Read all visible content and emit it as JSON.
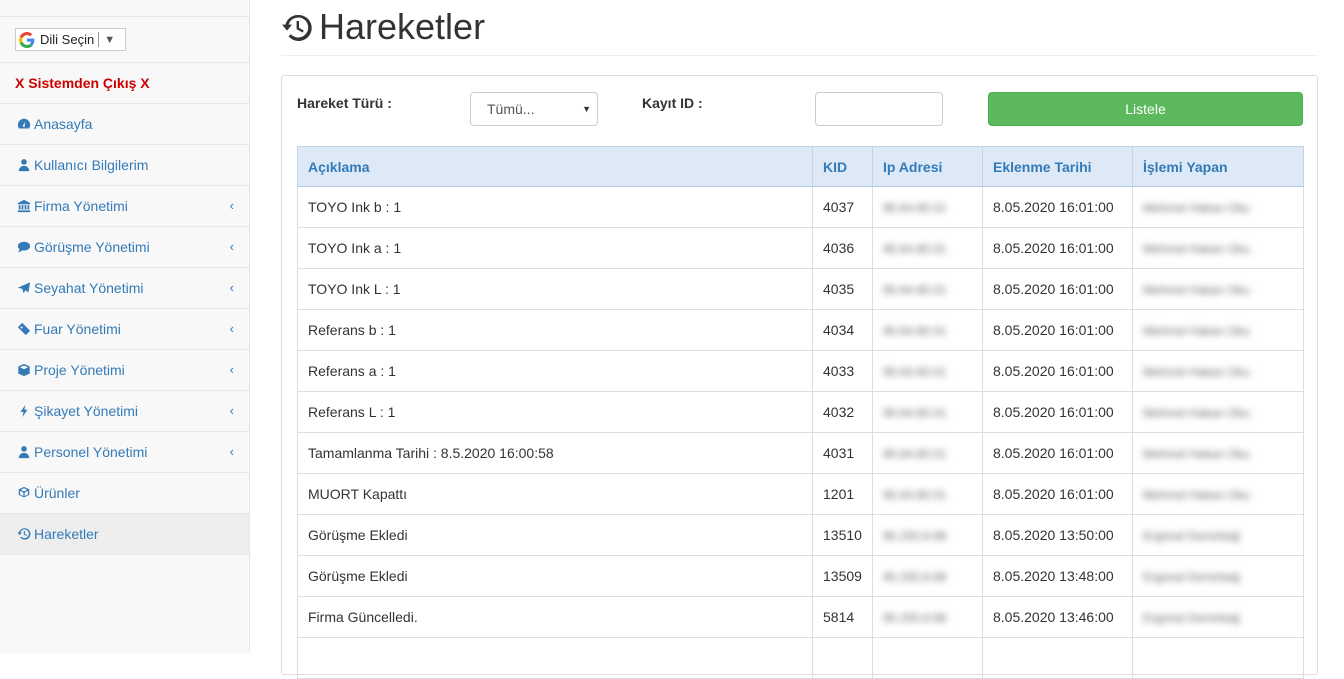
{
  "language": {
    "label": "Dili Seçin",
    "arrow": "▼"
  },
  "sidebar": {
    "exit_label": "X Sistemden Çıkış X",
    "items": [
      {
        "label": "Anasayfa",
        "icon": "dashboard-icon"
      },
      {
        "label": "Kullanıcı Bilgilerim",
        "icon": "user-icon"
      },
      {
        "label": "Firma Yönetimi",
        "icon": "bank-icon",
        "expandable": true
      },
      {
        "label": "Görüşme Yönetimi",
        "icon": "comments-icon",
        "expandable": true
      },
      {
        "label": "Seyahat Yönetimi",
        "icon": "plane-icon",
        "expandable": true
      },
      {
        "label": "Fuar Yönetimi",
        "icon": "ticket-icon",
        "expandable": true
      },
      {
        "label": "Proje Yönetimi",
        "icon": "cube-icon",
        "expandable": true
      },
      {
        "label": "Şikayet Yönetimi",
        "icon": "bolt-icon",
        "expandable": true
      },
      {
        "label": "Personel Yönetimi",
        "icon": "user-icon",
        "expandable": true
      },
      {
        "label": "Ürünler",
        "icon": "cubes-icon"
      },
      {
        "label": "Hareketler",
        "icon": "history-icon",
        "active": true
      }
    ],
    "chevron": "‹"
  },
  "page": {
    "title": "Hareketler"
  },
  "filters": {
    "type_label": "Hareket Türü :",
    "type_selected": "Tümü...",
    "id_label": "Kayıt ID :",
    "id_value": "",
    "submit_label": "Listele"
  },
  "table": {
    "headers": [
      "Açıklama",
      "KID",
      "Ip Adresi",
      "Eklenme Tarihi",
      "İşlemi Yapan"
    ],
    "rows": [
      [
        "TOYO Ink b : 1",
        "4037",
        "95.64.80.01",
        "8.05.2020 16:01:00",
        "Mehmet Hakan Oku"
      ],
      [
        "TOYO Ink a : 1",
        "4036",
        "95.64.80.01",
        "8.05.2020 16:01:00",
        "Mehmet Hakan Oku"
      ],
      [
        "TOYO Ink L : 1",
        "4035",
        "95.64.80.01",
        "8.05.2020 16:01:00",
        "Mehmet Hakan Oku"
      ],
      [
        "Referans b : 1",
        "4034",
        "95.64.80.01",
        "8.05.2020 16:01:00",
        "Mehmet Hakan Oku"
      ],
      [
        "Referans a : 1",
        "4033",
        "95.64.80.01",
        "8.05.2020 16:01:00",
        "Mehmet Hakan Oku"
      ],
      [
        "Referans L : 1",
        "4032",
        "95.64.80.01",
        "8.05.2020 16:01:00",
        "Mehmet Hakan Oku"
      ],
      [
        "Tamamlanma Tarihi : 8.5.2020 16:00:58",
        "4031",
        "95.64.80.01",
        "8.05.2020 16:01:00",
        "Mehmet Hakan Oku"
      ],
      [
        "MUORT Kapattı",
        "1201",
        "95.64.80.01",
        "8.05.2020 16:01:00",
        "Mehmet Hakan Oku"
      ],
      [
        "Görüşme Ekledi",
        "13510",
        "95.255.8.98",
        "8.05.2020 13:50:00",
        "Ergünal Demirbağ"
      ],
      [
        "Görüşme Ekledi",
        "13509",
        "95.255.8.98",
        "8.05.2020 13:48:00",
        "Ergünal Demirbağ"
      ],
      [
        "Firma Güncelledi.",
        "5814",
        "95.255.8.98",
        "8.05.2020 13:46:00",
        "Ergünal Demirbağ"
      ],
      [
        "",
        "",
        "",
        "",
        ""
      ]
    ]
  }
}
